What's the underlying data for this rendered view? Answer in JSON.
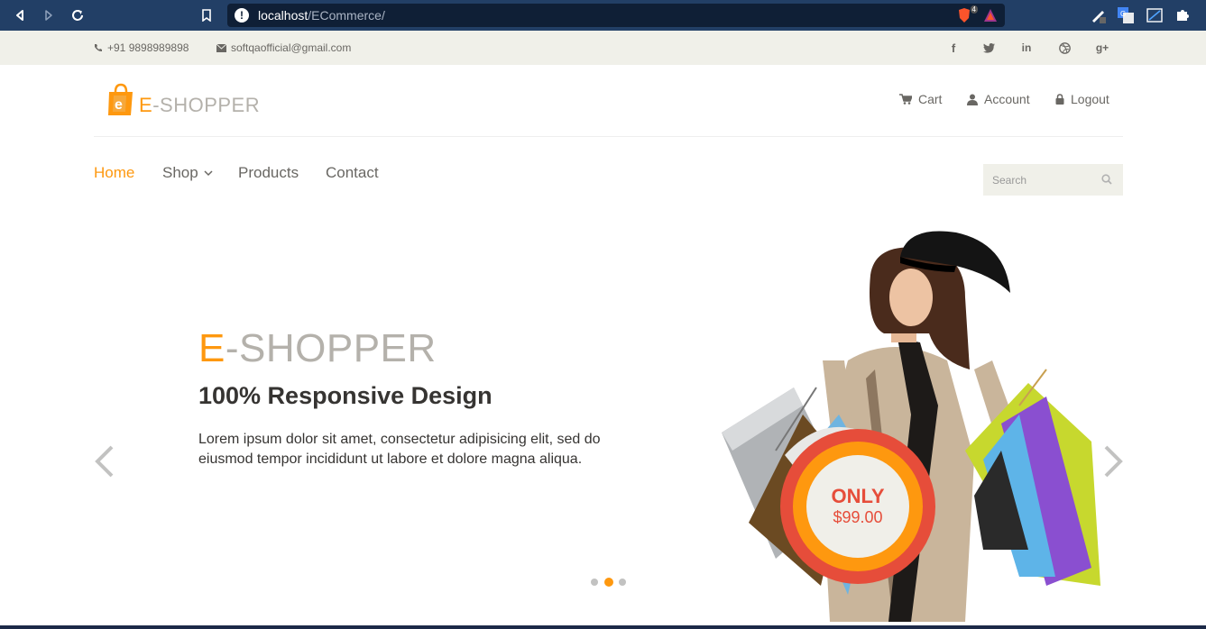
{
  "browser": {
    "url_host": "localhost",
    "url_path": "/ECommerce/",
    "brave_badge": "4"
  },
  "contact": {
    "phone": "+91 9898989898",
    "email": "softqaofficial@gmail.com"
  },
  "social": {
    "facebook": "f",
    "linkedin": "in",
    "googleplus": "g+"
  },
  "logo": {
    "prefix": "E",
    "text": "-SHOPPER"
  },
  "header": {
    "cart": "Cart",
    "account": "Account",
    "logout": "Logout"
  },
  "nav": {
    "home": "Home",
    "shop": "Shop",
    "products": "Products",
    "contact": "Contact"
  },
  "search": {
    "placeholder": "Search"
  },
  "slide": {
    "title_prefix": "E",
    "title_rest": "-SHOPPER",
    "subtitle": "100% Responsive Design",
    "text": "Lorem ipsum dolor sit amet, consectetur adipisicing elit, sed do eiusmod tempor incididunt ut labore et dolore magna aliqua.",
    "badge_only": "ONLY",
    "badge_price": "$99.00"
  },
  "colors": {
    "accent": "#fe980f",
    "badge_red": "#e64d3a",
    "chrome": "#223f66"
  }
}
